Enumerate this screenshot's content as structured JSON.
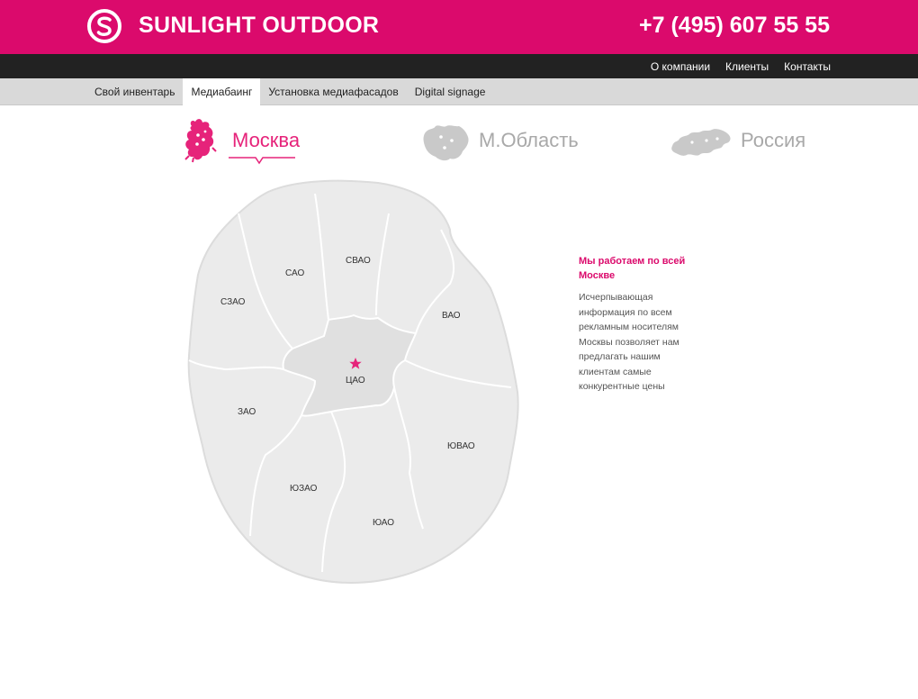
{
  "colors": {
    "brand": "#db0a6c",
    "dark_nav": "#222222",
    "tab_bar": "#d9d9d9",
    "map_fill": "#f2f2f2",
    "center_fill": "#e0e0e0",
    "star": "#e6237a"
  },
  "header": {
    "brand_name": "SUNLIGHT OUTDOOR",
    "phone": "+7 (495) 607 55 55",
    "logo_icon": "s-circle-logo-icon"
  },
  "top_nav": {
    "items": [
      {
        "label": "О компании"
      },
      {
        "label": "Клиенты"
      },
      {
        "label": "Контакты"
      }
    ]
  },
  "tabs": [
    {
      "label": "Свой инвентарь",
      "active": false
    },
    {
      "label": "Медиабаинг",
      "active": true
    },
    {
      "label": "Установка медиафасадов",
      "active": false
    },
    {
      "label": "Digital signage",
      "active": false
    }
  ],
  "regions": [
    {
      "label": "Москва",
      "active": true,
      "icon": "moscow-map-icon"
    },
    {
      "label": "М.Область",
      "active": false,
      "icon": "moscow-oblast-map-icon"
    },
    {
      "label": "Россия",
      "active": false,
      "icon": "russia-map-icon"
    }
  ],
  "map": {
    "districts": {
      "cao": "ЦАО",
      "sao": "САО",
      "svao": "СВАО",
      "vao": "ВАО",
      "yuvao": "ЮВАО",
      "yuao": "ЮАО",
      "yuzao": "ЮЗАО",
      "zao": "ЗАО",
      "szao": "СЗАО"
    }
  },
  "info": {
    "title": "Мы работаем по всей Москве",
    "body": "Исчерпывающая информация по всем рекламным носителям Москвы позволяет нам предлагать нашим клиентам самые конкурентные цены"
  }
}
